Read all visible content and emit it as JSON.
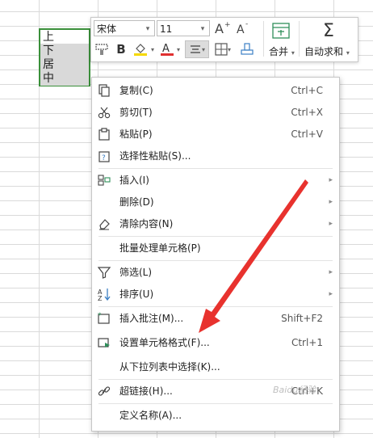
{
  "cells": [
    "上",
    "下",
    "居",
    "中"
  ],
  "toolbar": {
    "font_name": "宋体",
    "font_size": "11",
    "merge_label": "合并",
    "autosum_label": "自动求和"
  },
  "menu": {
    "copy": {
      "label": "复制(C)",
      "shortcut": "Ctrl+C"
    },
    "cut": {
      "label": "剪切(T)",
      "shortcut": "Ctrl+X"
    },
    "paste": {
      "label": "粘贴(P)",
      "shortcut": "Ctrl+V"
    },
    "paste_special": {
      "label": "选择性粘贴(S)..."
    },
    "insert": {
      "label": "插入(I)"
    },
    "delete": {
      "label": "删除(D)"
    },
    "clear": {
      "label": "清除内容(N)"
    },
    "batch": {
      "label": "批量处理单元格(P)"
    },
    "filter": {
      "label": "筛选(L)"
    },
    "sort": {
      "label": "排序(U)"
    },
    "comment": {
      "label": "插入批注(M)...",
      "shortcut": "Shift+F2"
    },
    "format_cells": {
      "label": "设置单元格格式(F)...",
      "shortcut": "Ctrl+1"
    },
    "pick_list": {
      "label": "从下拉列表中选择(K)..."
    },
    "hyperlink": {
      "label": "超链接(H)...",
      "shortcut": "Ctrl+K"
    },
    "define_name": {
      "label": "定义名称(A)..."
    }
  },
  "watermark": "Baidu经验",
  "colors": {
    "selection_border": "#3a8f3a",
    "annotation_arrow": "#e8322e",
    "font_color_bar": "#e03030",
    "fill_color_bar": "#f5d800"
  }
}
